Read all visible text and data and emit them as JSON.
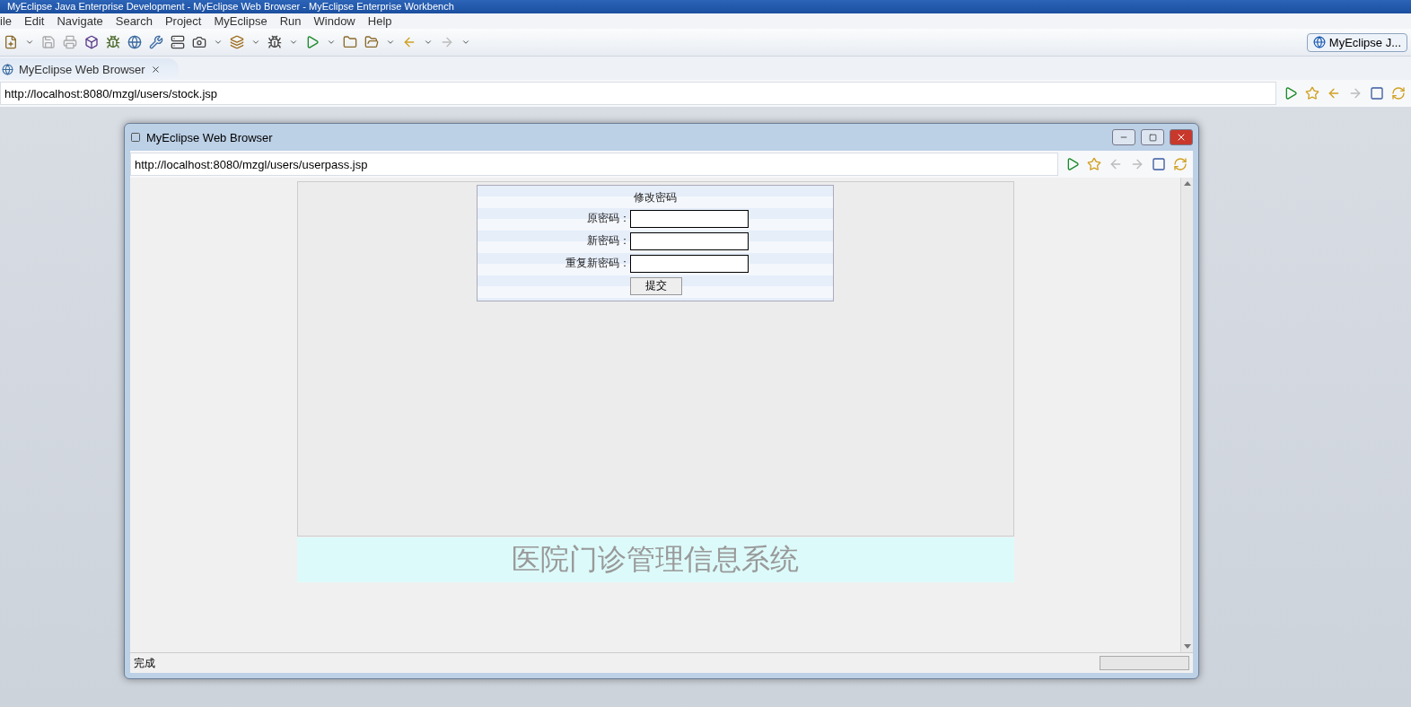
{
  "window": {
    "title": "MyEclipse Java Enterprise Development - MyEclipse Web Browser - MyEclipse Enterprise Workbench"
  },
  "menu": [
    "ile",
    "Edit",
    "Navigate",
    "Search",
    "Project",
    "MyEclipse",
    "Run",
    "Window",
    "Help"
  ],
  "perspective": {
    "label": "MyEclipse J..."
  },
  "editor_tab": {
    "label": "MyEclipse Web Browser"
  },
  "address": {
    "value": "http://localhost:8080/mzgl/users/stock.jsp"
  },
  "popup": {
    "title": "MyEclipse Web Browser",
    "address": "http://localhost:8080/mzgl/users/userpass.jsp",
    "form": {
      "title": "修改密码",
      "fields": [
        {
          "label": "原密码："
        },
        {
          "label": "新密码："
        },
        {
          "label": "重复新密码："
        }
      ],
      "submit": "提交"
    },
    "footer": "医院门诊管理信息系统",
    "status": "完成"
  }
}
